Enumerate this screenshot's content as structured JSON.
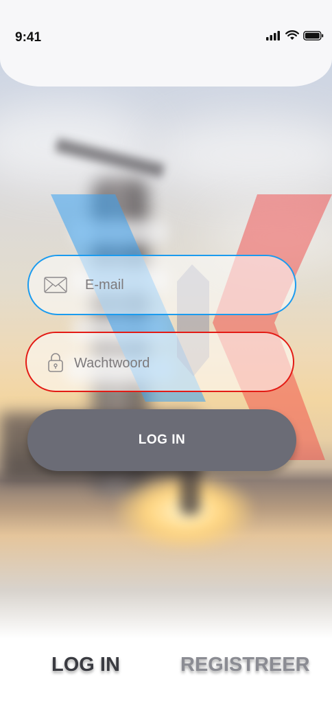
{
  "status_bar": {
    "time": "9:41",
    "icons": [
      "signal-icon",
      "wifi-icon",
      "battery-icon"
    ]
  },
  "form": {
    "email": {
      "placeholder": "E-mail",
      "icon": "envelope-icon",
      "border_color": "#1a9bef"
    },
    "password": {
      "placeholder": "Wachtwoord",
      "icon": "lock-icon",
      "border_color": "#e31a14"
    },
    "submit_label": "LOG IN",
    "submit_color": "#6b6c76"
  },
  "tabs": [
    {
      "label": "LOG IN",
      "active": true,
      "color": "#3a3b41"
    },
    {
      "label": "REGISTREER",
      "active": false,
      "color": "#8b8c93"
    }
  ],
  "brand": {
    "logo": "x-logo",
    "colors": [
      "#3ba2f2",
      "#f23a3a"
    ]
  }
}
